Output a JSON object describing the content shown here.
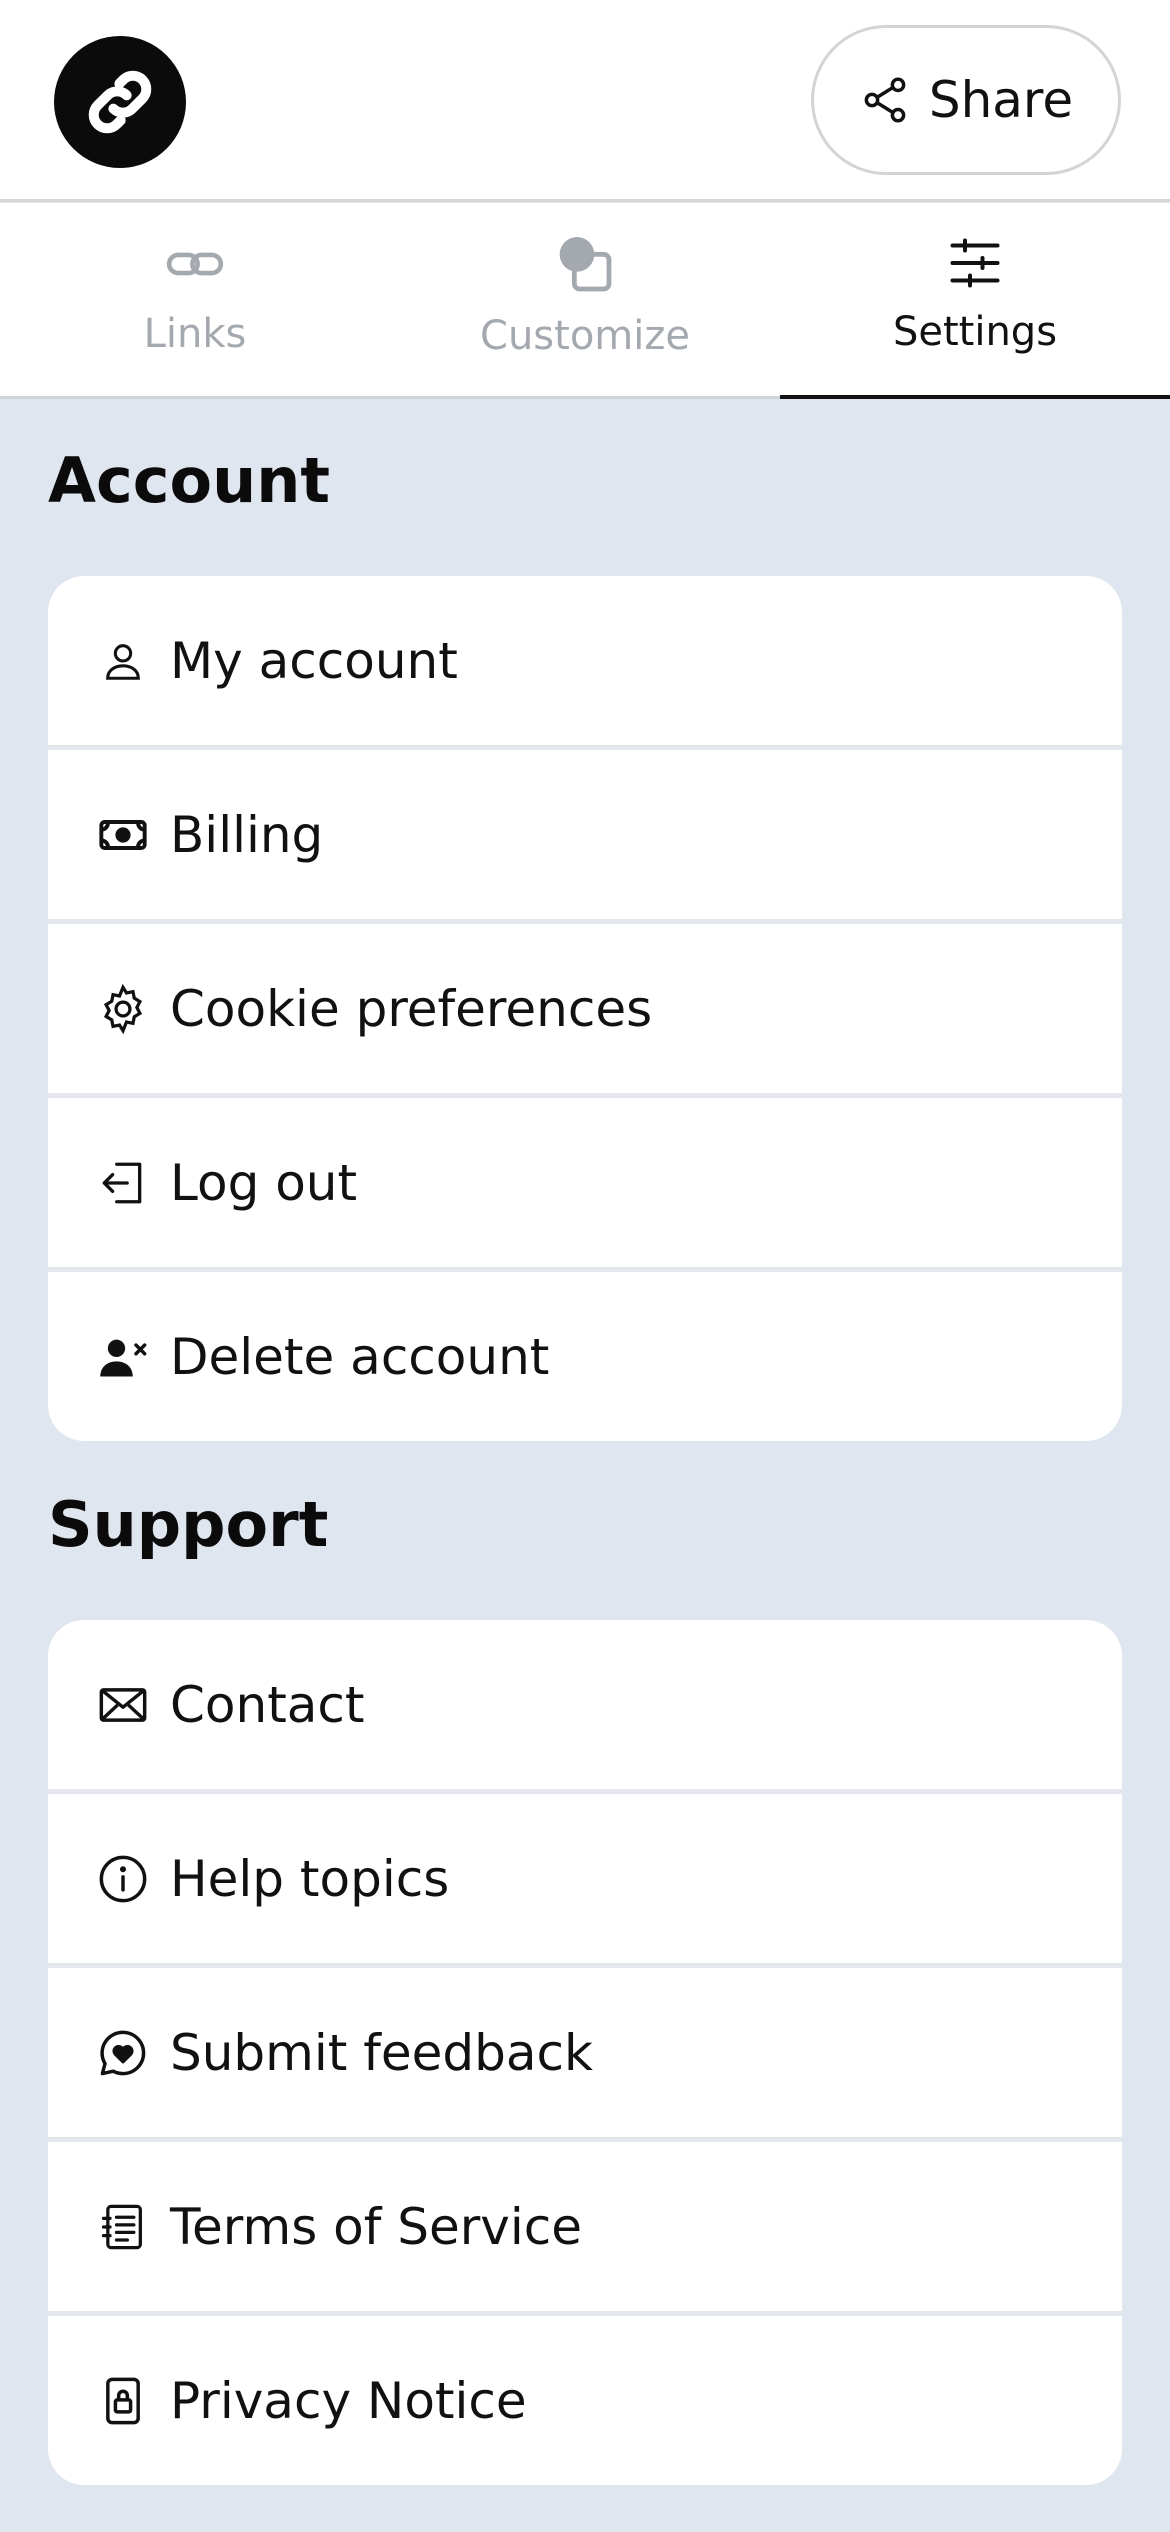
{
  "header": {
    "logo_icon": "link-chain-icon",
    "share": {
      "label": "Share",
      "icon": "share-nodes-icon"
    }
  },
  "tabs": [
    {
      "label": "Links",
      "icon": "link-icon",
      "active": false
    },
    {
      "label": "Customize",
      "icon": "customize-shapes-icon",
      "active": false
    },
    {
      "label": "Settings",
      "icon": "sliders-icon",
      "active": true
    }
  ],
  "sections": {
    "account": {
      "title": "Account",
      "items": [
        {
          "label": "My account",
          "icon": "person-icon"
        },
        {
          "label": "Billing",
          "icon": "banknote-icon"
        },
        {
          "label": "Cookie preferences",
          "icon": "gear-icon"
        },
        {
          "label": "Log out",
          "icon": "logout-icon"
        },
        {
          "label": "Delete account",
          "icon": "person-remove-icon"
        }
      ]
    },
    "support": {
      "title": "Support",
      "items": [
        {
          "label": "Contact",
          "icon": "envelope-icon"
        },
        {
          "label": "Help topics",
          "icon": "info-icon"
        },
        {
          "label": "Submit feedback",
          "icon": "chat-heart-icon"
        },
        {
          "label": "Terms of Service",
          "icon": "document-list-icon"
        },
        {
          "label": "Privacy Notice",
          "icon": "lock-document-icon"
        }
      ]
    }
  },
  "colors": {
    "page_background": "#e0e6ef",
    "card_background": "#ffffff",
    "text": "#111111",
    "inactive_tab": "#a4a9b0"
  }
}
